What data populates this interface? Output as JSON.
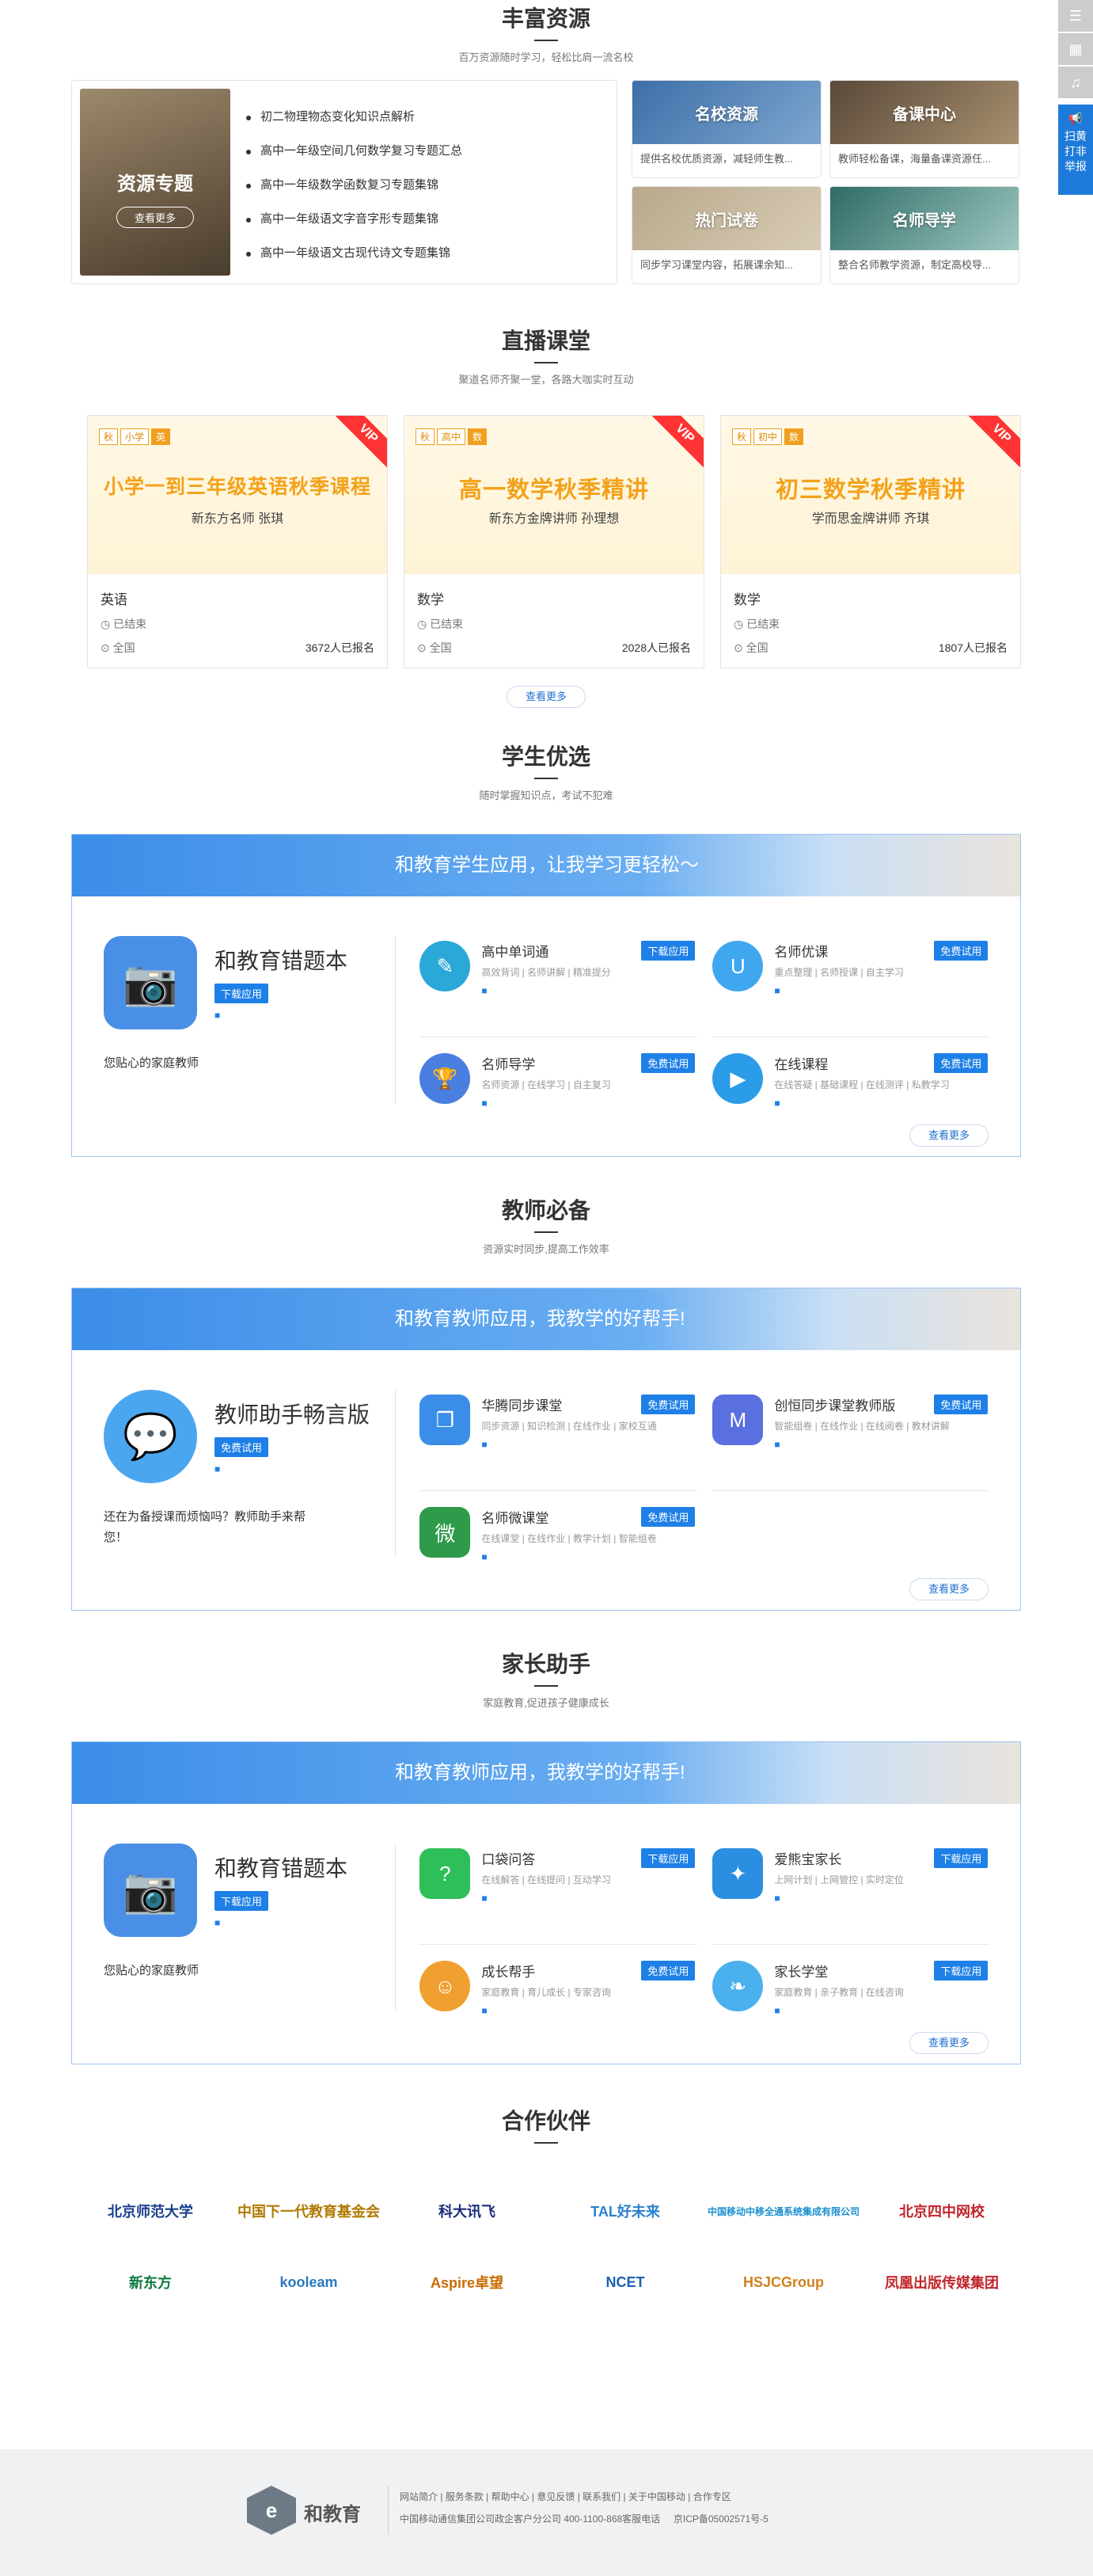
{
  "side": {
    "scan_label": "扫黄打非举报"
  },
  "resources": {
    "title": "丰富资源",
    "subtitle": "百万资源随时学习，轻松比肩一流名校",
    "feature": {
      "title": "资源专题",
      "button": "查看更多"
    },
    "list": [
      "初二物理物态变化知识点解析",
      "高中一年级空间几何数学复习专题汇总",
      "高中一年级数学函数复习专题集锦",
      "高中一年级语文字音字形专题集锦",
      "高中一年级语文古现代诗文专题集锦"
    ],
    "cards": [
      {
        "name": "名校资源",
        "desc": "提供名校优质资源，减轻师生教..."
      },
      {
        "name": "备课中心",
        "desc": "教师轻松备课，海量备课资源任..."
      },
      {
        "name": "热门试卷",
        "desc": "同步学习课堂内容，拓展课余知..."
      },
      {
        "name": "名师导学",
        "desc": "整合名师教学资源，制定高校导..."
      }
    ]
  },
  "live": {
    "title": "直播课堂",
    "subtitle": "聚道名师齐聚一堂，各路大咖实时互动",
    "more": "查看更多",
    "courses": [
      {
        "tags": [
          "秋",
          "小学",
          "英"
        ],
        "banner": "小学一到三年级英语秋季课程",
        "teacher": "新东方名师 张琪",
        "subject": "英语",
        "status": "已结束",
        "region": "全国",
        "count": "3672人已报名"
      },
      {
        "tags": [
          "秋",
          "高中",
          "数"
        ],
        "banner": "高一数学秋季精讲",
        "teacher": "新东方金牌讲师 孙理想",
        "subject": "数学",
        "status": "已结束",
        "region": "全国",
        "count": "2028人已报名"
      },
      {
        "tags": [
          "秋",
          "初中",
          "数"
        ],
        "banner": "初三数学秋季精讲",
        "teacher": "学而思金牌讲师 齐琪",
        "subject": "数学",
        "status": "已结束",
        "region": "全国",
        "count": "1807人已报名"
      }
    ],
    "vip": "VIP"
  },
  "student": {
    "title": "学生优选",
    "subtitle": "随时掌握知识点，考试不犯难",
    "banner": "和教育学生应用，让我学习更轻松～",
    "main": {
      "name": "和教育错题本",
      "button": "下载应用",
      "slogan": "您贴心的家庭教师"
    },
    "apps": [
      {
        "name": "高中单词通",
        "btn": "下载应用",
        "features": "高效背词 | 名师讲解 | 精准提分"
      },
      {
        "name": "名师优课",
        "btn": "免费试用",
        "features": "重点整理 | 名师授课 | 自主学习"
      },
      {
        "name": "名师导学",
        "btn": "免费试用",
        "features": "名师资源 | 在线学习 | 自主复习"
      },
      {
        "name": "在线课程",
        "btn": "免费试用",
        "features": "在线答疑 | 基础课程 | 在线测评 | 私教学习"
      }
    ],
    "more": "查看更多"
  },
  "teacher": {
    "title": "教师必备",
    "subtitle": "资源实时同步,提高工作效率",
    "banner": "和教育教师应用，我教学的好帮手!",
    "main": {
      "name": "教师助手畅言版",
      "button": "免费试用",
      "slogan": "还在为备授课而烦恼吗？教师助手来帮您！"
    },
    "apps": [
      {
        "name": "华腾同步课堂",
        "btn": "免费试用",
        "features": "同步资源 | 知识检测 | 在线作业 | 家校互通"
      },
      {
        "name": "创恒同步课堂教师版",
        "btn": "免费试用",
        "features": "智能组卷 | 在线作业 | 在线阅卷 | 教材讲解"
      },
      {
        "name": "名师微课堂",
        "btn": "免费试用",
        "features": "在线课堂 | 在线作业 | 教学计划 | 智能组卷"
      }
    ],
    "more": "查看更多"
  },
  "parent": {
    "title": "家长助手",
    "subtitle": "家庭教育,促进孩子健康成长",
    "banner": "和教育教师应用，我教学的好帮手!",
    "main": {
      "name": "和教育错题本",
      "button": "下载应用",
      "slogan": "您贴心的家庭教师"
    },
    "apps": [
      {
        "name": "口袋问答",
        "btn": "下载应用",
        "features": "在线解答 | 在线提问 | 互动学习"
      },
      {
        "name": "爱熊宝家长",
        "btn": "下载应用",
        "features": "上网计划 | 上网管控 | 实时定位"
      },
      {
        "name": "成长帮手",
        "btn": "免费试用",
        "features": "家庭教育 | 育儿成长 | 专家咨询"
      },
      {
        "name": "家长学堂",
        "btn": "下载应用",
        "features": "家庭教育 | 亲子教育 | 在线咨询"
      }
    ],
    "more": "查看更多"
  },
  "partners": {
    "title": "合作伙伴",
    "logos": [
      {
        "name": "北京师范大学",
        "color": "#1a3f8c"
      },
      {
        "name": "中国下一代教育基金会",
        "color": "#b07a00"
      },
      {
        "name": "科大讯飞",
        "color": "#1a2d7a"
      },
      {
        "name": "TAL好未来",
        "color": "#2a80d0"
      },
      {
        "name": "中国移动中移全通系统集成有限公司",
        "color": "#1a8fcf"
      },
      {
        "name": "北京四中网校",
        "color": "#c0262b"
      },
      {
        "name": "新东方",
        "color": "#0b7a3e"
      },
      {
        "name": "kooleam",
        "color": "#2a7ac0"
      },
      {
        "name": "Aspire卓望",
        "color": "#c96b00"
      },
      {
        "name": "NCET",
        "color": "#1d5fb0"
      },
      {
        "name": "HSJCGroup",
        "color": "#d08020"
      },
      {
        "name": "凤凰出版传媒集团",
        "color": "#c0262b"
      }
    ]
  },
  "footer": {
    "brand": "和教育",
    "links": "网站简介 | 服务条款 | 帮助中心 | 意见反馈 | 联系我们 | 关于中国移动 | 合作专区",
    "company": "中国移动通信集团公司政企客户分公司 400-1100-868客服电话",
    "icp": "京ICP备05002571号-5"
  }
}
